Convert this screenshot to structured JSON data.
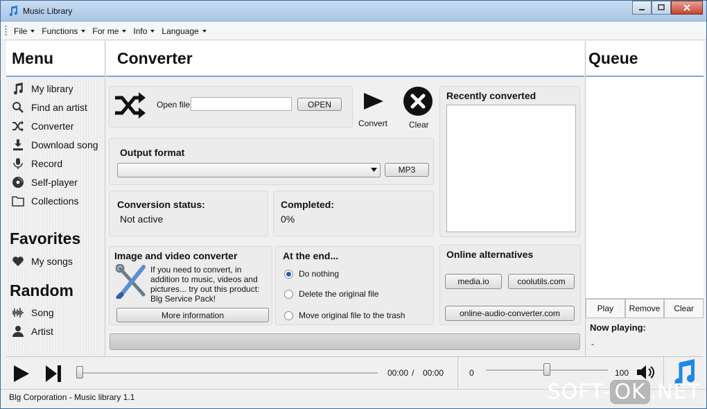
{
  "window": {
    "title": "Music Library"
  },
  "menu": [
    {
      "label": "File"
    },
    {
      "label": "Functions"
    },
    {
      "label": "For me"
    },
    {
      "label": "Info"
    },
    {
      "label": "Language"
    }
  ],
  "sidebar": {
    "title": "Menu",
    "items": [
      {
        "label": "My library",
        "icon": "music-note-icon"
      },
      {
        "label": "Find an artist",
        "icon": "search-icon"
      },
      {
        "label": "Converter",
        "icon": "shuffle-icon"
      },
      {
        "label": "Download song",
        "icon": "download-icon"
      },
      {
        "label": "Record",
        "icon": "microphone-icon"
      },
      {
        "label": "Self-player",
        "icon": "disc-icon"
      },
      {
        "label": "Collections",
        "icon": "folder-icon"
      }
    ],
    "favorites_title": "Favorites",
    "favorites": [
      {
        "label": "My songs",
        "icon": "heart-icon"
      }
    ],
    "random_title": "Random",
    "random": [
      {
        "label": "Song",
        "icon": "waveform-icon"
      },
      {
        "label": "Artist",
        "icon": "person-icon"
      }
    ]
  },
  "converter": {
    "title": "Converter",
    "open_file_label": "Open file",
    "open_file_value": "",
    "open_button": "OPEN",
    "convert_label": "Convert",
    "clear_label": "Clear",
    "output_format_label": "Output format",
    "output_format_value": "",
    "format_button": "MP3",
    "status_label": "Conversion status:",
    "status_value": "Not active",
    "completed_label": "Completed:",
    "completed_value": "0%",
    "recent_title": "Recently converted",
    "image_video": {
      "title": "Image and video converter",
      "text": "If you need to convert, in addition to music, videos and pictures... try out this product: Blg Service Pack!",
      "button": "More information"
    },
    "at_end": {
      "title": "At the end...",
      "options": [
        {
          "label": "Do nothing",
          "selected": true
        },
        {
          "label": "Delete the original file",
          "selected": false
        },
        {
          "label": "Move original file to the trash",
          "selected": false
        }
      ]
    },
    "online": {
      "title": "Online alternatives",
      "buttons": [
        "media.io",
        "coolutils.com",
        "online-audio-converter.com"
      ]
    }
  },
  "queue": {
    "title": "Queue",
    "buttons": [
      "Play",
      "Remove",
      "Clear"
    ],
    "now_playing_label": "Now playing:",
    "now_playing_value": "-"
  },
  "player": {
    "time_current": "00:00",
    "time_separator": "/",
    "time_total": "00:00",
    "volume_min": "0",
    "volume_max": "100",
    "progress": 0,
    "volume_fraction": 0.5
  },
  "status": {
    "text": "Blg Corporation - Music library 1.1"
  },
  "watermark": {
    "left": "SOFT-",
    "ok": "OK",
    "right": ".NET"
  },
  "colors": {
    "accent": "#7aa7d6",
    "title_bar": "#a9c6e6",
    "note_blue": "#1e88e5"
  }
}
